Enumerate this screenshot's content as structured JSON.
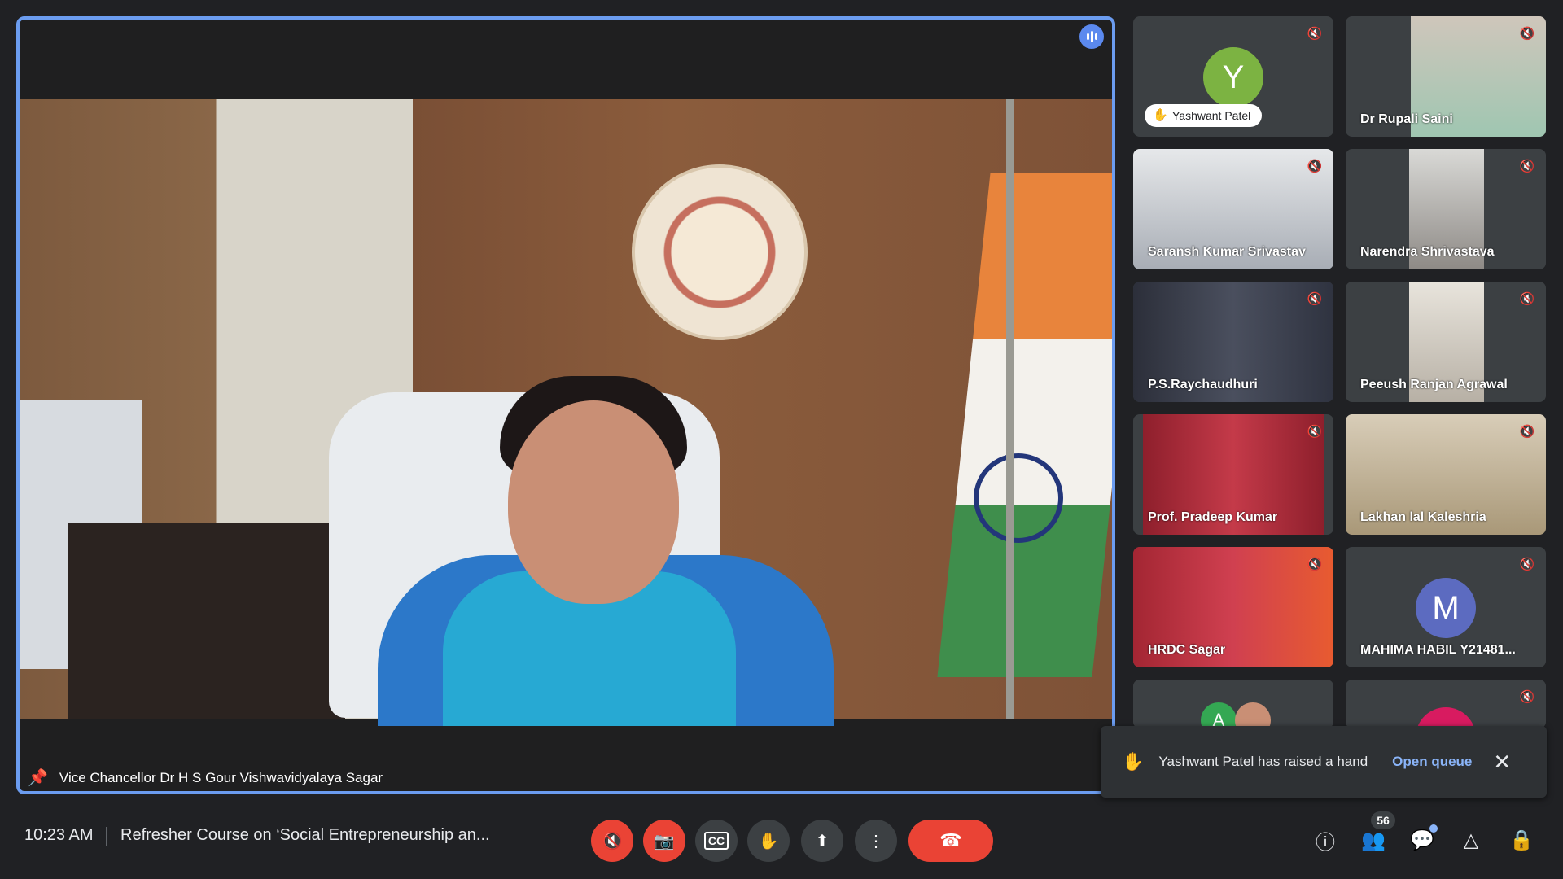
{
  "main_speaker": {
    "label": "Vice Chancellor Dr H S Gour Vishwavidyalaya Sagar"
  },
  "participants": [
    {
      "name": "Yashwant Patel",
      "avatar_letter": "Y",
      "avatar_color": "#7cb342",
      "muted": true,
      "hand_raised": true
    },
    {
      "name": "Dr Rupali Saini",
      "muted": true
    },
    {
      "name": "Saransh Kumar Srivastav",
      "muted": true
    },
    {
      "name": "Narendra Shrivastava",
      "muted": true
    },
    {
      "name": "P.S.Raychaudhuri",
      "muted": true
    },
    {
      "name": "Peeush Ranjan Agrawal",
      "muted": true
    },
    {
      "name": "Prof. Pradeep Kumar",
      "muted": true
    },
    {
      "name": "Lakhan lal Kaleshria",
      "muted": true
    },
    {
      "name": "HRDC Sagar",
      "muted": true
    },
    {
      "name": "MAHIMA HABIL Y21481...",
      "avatar_letter": "M",
      "avatar_color": "#5c6bc0",
      "muted": true
    },
    {
      "name": "",
      "avatar_letter": "A",
      "avatar_color": "#34a853"
    },
    {
      "name": "",
      "avatar_color": "#d81b60",
      "muted": true
    }
  ],
  "toast": {
    "message": "Yashwant Patel has raised a hand",
    "action": "Open queue"
  },
  "bottom_bar": {
    "time": "10:23 AM",
    "meeting_title": "Refresher Course on ‘Social Entrepreneurship an...",
    "participant_count": "56"
  },
  "colors": {
    "background": "#202124",
    "active_speaker_border": "#6b9cf0",
    "danger": "#ea4335",
    "link": "#8ab4f8"
  }
}
